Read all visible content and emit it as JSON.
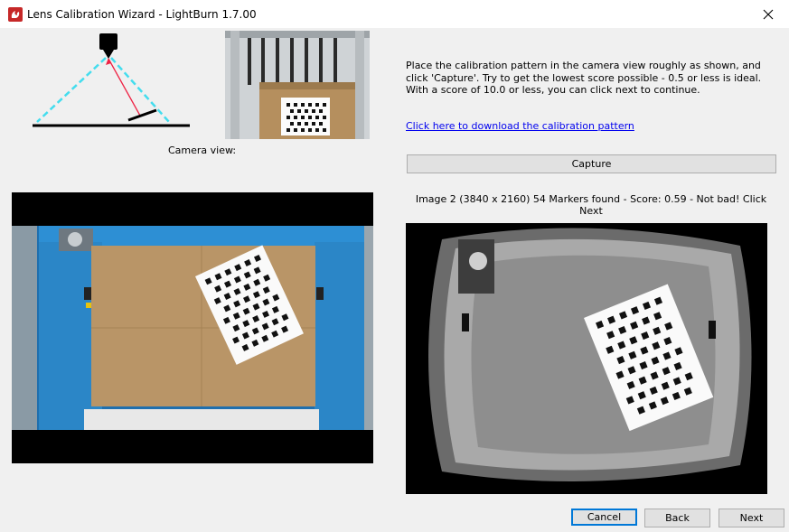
{
  "window": {
    "title": "Lens Calibration Wizard - LightBurn 1.7.00",
    "close_icon": "close-icon",
    "app_icon": "lightburn-logo-icon"
  },
  "camera_view_label": "Camera view:",
  "instructions": "Place the calibration pattern in the camera view roughly as shown, and click 'Capture'. Try to get the lowest score possible - 0.5 or less is ideal.  With a score of 10.0 or less, you can click next to continue.",
  "download_link": "Click here to download the calibration pattern",
  "capture_label": "Capture",
  "status": "Image 2 (3840 x 2160) 54 Markers found - Score: 0.59 - Not bad! Click Next",
  "buttons": {
    "cancel": "Cancel",
    "back": "Back",
    "next": "Next"
  },
  "colors": {
    "accent": "#0078d7",
    "link": "#0000ee",
    "machine_frame": "#2d8fd4",
    "diagram_dashed": "#44ddee",
    "diagram_arrow": "#ee2244"
  }
}
